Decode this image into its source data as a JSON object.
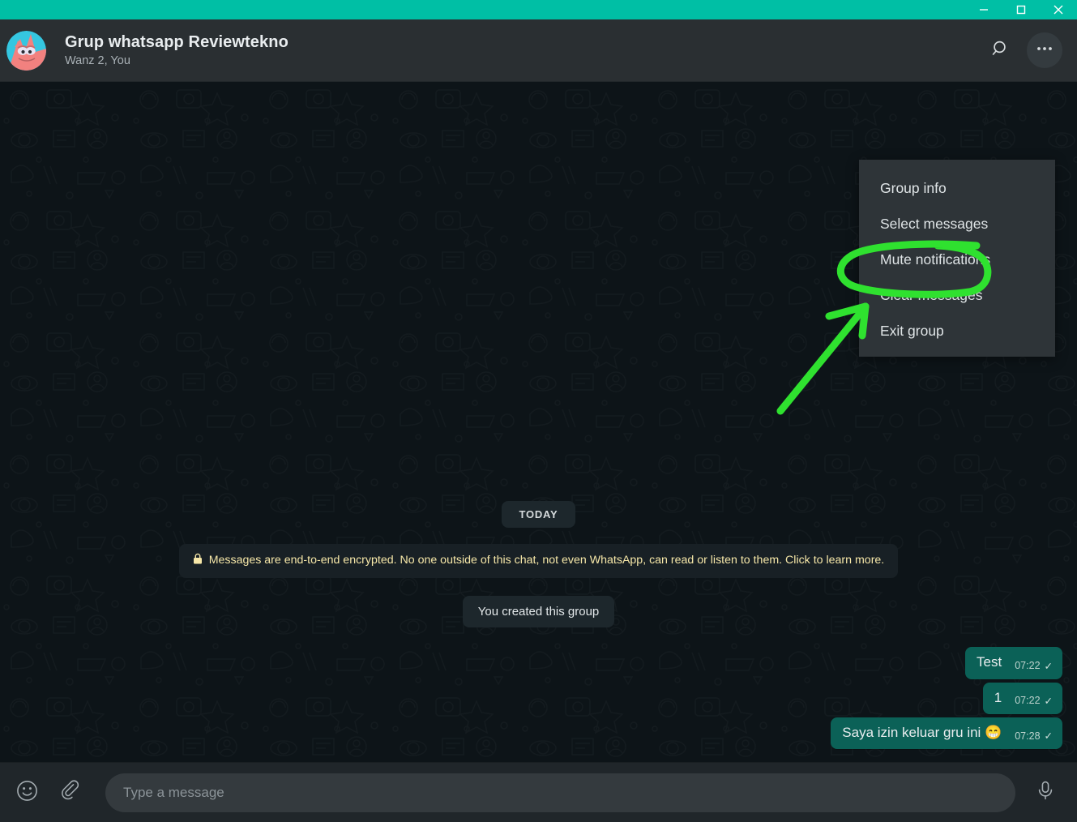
{
  "window": {
    "titlebar_color": "#00bfa5",
    "buttons": [
      {
        "name": "minimize",
        "glyph": "minimize-icon"
      },
      {
        "name": "maximize",
        "glyph": "maximize-icon"
      },
      {
        "name": "close",
        "glyph": "close-icon"
      }
    ]
  },
  "header": {
    "avatar_alt": "Patrick Star group photo",
    "title": "Grup whatsapp Reviewtekno",
    "subtitle": "Wanz 2, You",
    "search_icon": "search-icon",
    "menu_icon": "overflow-menu-icon"
  },
  "menu": {
    "visible": true,
    "items": [
      {
        "label": "Group info"
      },
      {
        "label": "Select messages"
      },
      {
        "label": "Mute notifications"
      },
      {
        "label": "Clear messages"
      },
      {
        "label": "Exit group"
      }
    ]
  },
  "annotation": {
    "color": "#2fe12f",
    "shapes": [
      "ellipse-around-exit-group",
      "arrow-pointing-up-right"
    ]
  },
  "chat": {
    "day_divider": "TODAY",
    "encryption_notice": "Messages are end-to-end encrypted. No one outside of this chat, not even WhatsApp, can read or listen to them. Click to learn more.",
    "system_message": "You created this group",
    "messages": [
      {
        "text": "Test",
        "emoji": "",
        "time": "07:22",
        "status": "✓",
        "outgoing": true
      },
      {
        "text": "1",
        "emoji": "",
        "time": "07:22",
        "status": "✓",
        "outgoing": true
      },
      {
        "text": "Saya izin keluar gru ini ",
        "emoji": "😁",
        "time": "07:28",
        "status": "✓",
        "outgoing": true
      }
    ]
  },
  "composer": {
    "emoji_icon": "emoji-icon",
    "attach_icon": "paperclip-icon",
    "placeholder": "Type a message",
    "value": "",
    "mic_icon": "microphone-icon"
  },
  "colors": {
    "titlebar": "#00bfa5",
    "header_bg": "#2a2f32",
    "chat_bg": "#0d1418",
    "bubble_out": "#0b6157",
    "menu_bg": "#2e3438",
    "notice_text": "#f6e7a8",
    "annotation_green": "#2fe12f"
  }
}
